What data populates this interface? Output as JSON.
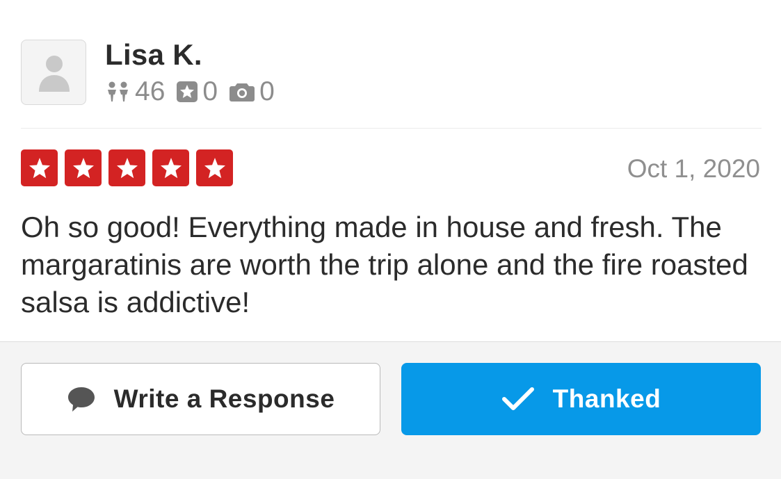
{
  "review": {
    "user": {
      "name": "Lisa K.",
      "avatar_icon": "default-user-icon",
      "friends_count": "46",
      "reviews_count": "0",
      "photos_count": "0"
    },
    "rating": 5,
    "rating_max": 5,
    "date": "Oct 1, 2020",
    "text": "Oh so good! Everything made in house and fresh. The margaratinis are worth the trip alone and the fire roasted salsa is addictive!"
  },
  "actions": {
    "write_response_label": "Write a Response",
    "write_response_icon": "speech-bubble-icon",
    "thanked_label": "Thanked",
    "thanked_icon": "checkmark-icon"
  },
  "colors": {
    "star_red": "#d32323",
    "thanked_blue": "#0799e8",
    "muted_text": "#8c8c8c"
  }
}
